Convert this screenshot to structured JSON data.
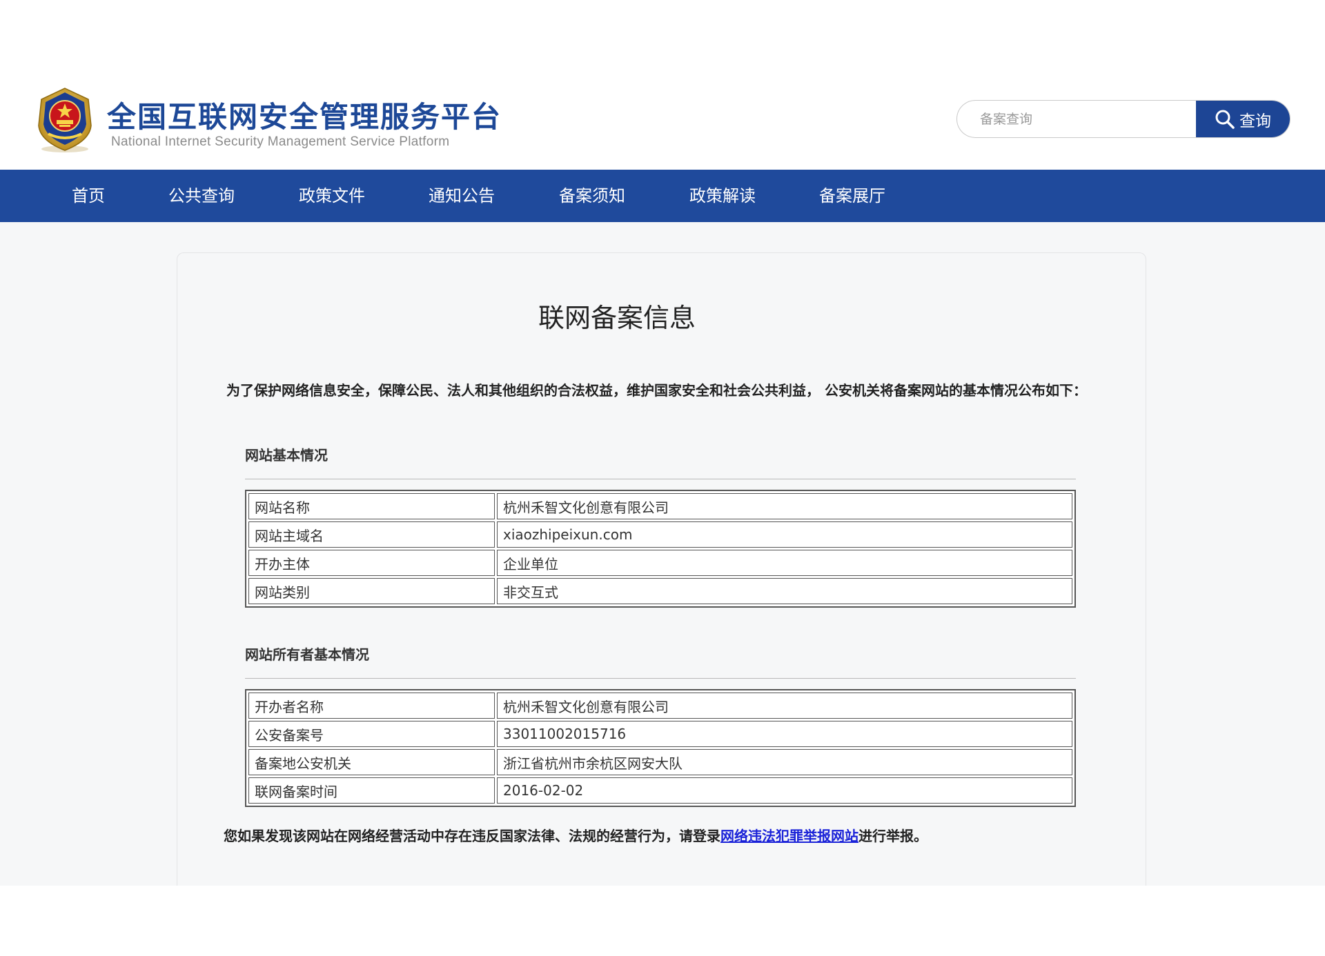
{
  "header": {
    "title": "全国互联网安全管理服务平台",
    "subtitle": "National Internet Security Management Service Platform",
    "search": {
      "placeholder": "备案查询",
      "button_label": "查询"
    }
  },
  "nav": {
    "items": [
      {
        "label": "首页"
      },
      {
        "label": "公共查询"
      },
      {
        "label": "政策文件"
      },
      {
        "label": "通知公告"
      },
      {
        "label": "备案须知"
      },
      {
        "label": "政策解读"
      },
      {
        "label": "备案展厅"
      }
    ]
  },
  "main": {
    "title": "联网备案信息",
    "intro": "为了保护网络信息安全，保障公民、法人和其他组织的合法权益，维护国家安全和社会公共利益， 公安机关将备案网站的基本情况公布如下：",
    "site_basic": {
      "heading": "网站基本情况",
      "rows": [
        {
          "label": "网站名称",
          "value": "杭州禾智文化创意有限公司"
        },
        {
          "label": "网站主域名",
          "value": "xiaozhipeixun.com"
        },
        {
          "label": "开办主体",
          "value": "企业单位"
        },
        {
          "label": "网站类别",
          "value": "非交互式"
        }
      ]
    },
    "owner_basic": {
      "heading": "网站所有者基本情况",
      "rows": [
        {
          "label": "开办者名称",
          "value": "杭州禾智文化创意有限公司"
        },
        {
          "label": "公安备案号",
          "value": "33011002015716"
        },
        {
          "label": "备案地公安机关",
          "value": "浙江省杭州市余杭区网安大队"
        },
        {
          "label": "联网备案时间",
          "value": "2016-02-02"
        }
      ]
    },
    "report": {
      "prefix": "您如果发现该网站在网络经营活动中存在违反国家法律、法规的经营行为，请登录",
      "link": "网络违法犯罪举报网站",
      "suffix": "进行举报。"
    }
  },
  "colors": {
    "brand_blue": "#1f4a9c",
    "title_blue": "#1d4897",
    "link_blue": "#1a22d8"
  }
}
